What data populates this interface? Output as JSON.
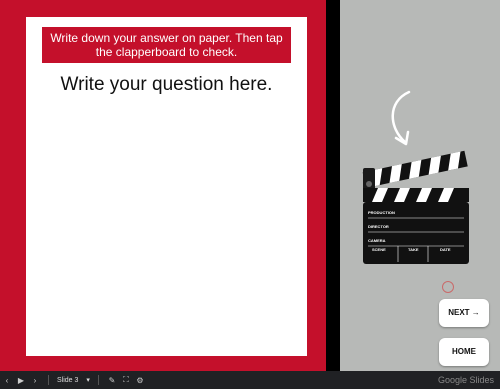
{
  "slide": {
    "instruction": "Write down your answer on paper. Then tap the clapperboard to check.",
    "question": "Write your question here.",
    "clapperboard": {
      "production": "PRODUCTION",
      "director": "DIRECTOR",
      "camera": "CAMERA",
      "scene": "SCENE",
      "take": "TAKE",
      "date": "DATE"
    },
    "next_label": "NEXT →",
    "home_label": "HOME"
  },
  "toolbar": {
    "slide_label": "Slide 3",
    "brand": "Google Slides"
  },
  "colors": {
    "red": "#c4102b",
    "gray": "#b7b9b7",
    "toolbar": "#202124"
  },
  "icons": [
    "prev-icon",
    "play-icon",
    "next-icon",
    "dropdown-icon",
    "pen-icon",
    "fullscreen-icon",
    "settings-icon",
    "undo-arrow-icon",
    "clapperboard-icon"
  ]
}
